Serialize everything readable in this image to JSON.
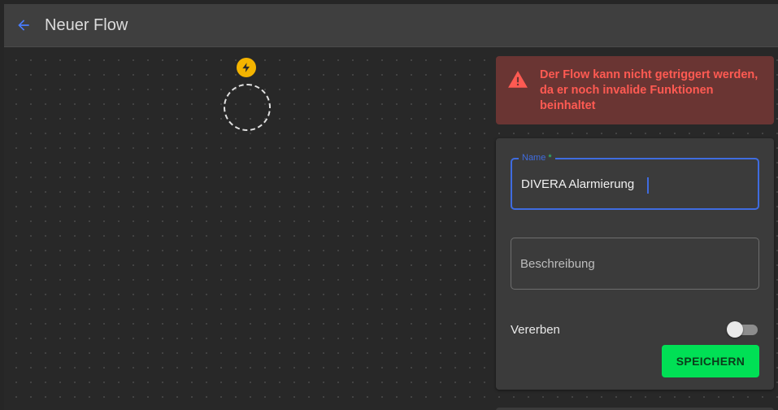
{
  "header": {
    "title": "Neuer Flow",
    "back_icon": "arrow-left-icon"
  },
  "canvas": {
    "trigger_icon": "bolt-icon",
    "trigger_badge_color": "#f4b400"
  },
  "alert": {
    "icon": "warning-triangle-icon",
    "message": "Der Flow kann nicht getriggert werden, da er noch invalide Funktionen beinhaltet"
  },
  "form": {
    "name_label": "Name",
    "name_required_marker": "*",
    "name_value": "DIVERA Alarmierung",
    "description_placeholder": "Beschreibung",
    "description_value": "",
    "inherit_label": "Vererben",
    "inherit_enabled": false,
    "save_label": "SPEICHERN"
  },
  "colors": {
    "accent_blue": "#3f6ce0",
    "error_red": "#ff5a52",
    "save_green": "#00e055"
  }
}
